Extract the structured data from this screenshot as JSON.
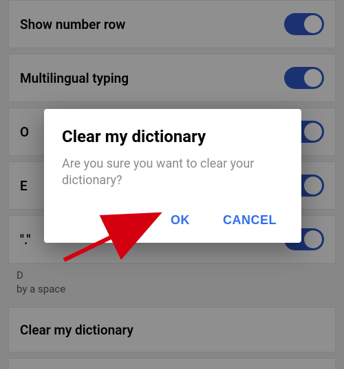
{
  "settings": {
    "rows": [
      {
        "label": "Show number row",
        "toggle": true
      },
      {
        "label": "Multilingual typing",
        "toggle": true
      },
      {
        "label": "O",
        "toggle": true
      },
      {
        "label": "E",
        "toggle": true
      },
      {
        "label": "\".\"",
        "toggle": true
      }
    ],
    "hint_partial_prefix": "D",
    "hint_partial_suffix": "by a space",
    "clear_row_label": "Clear my dictionary"
  },
  "dialog": {
    "title": "Clear my dictionary",
    "message": "Are you sure you want to clear your dictionary?",
    "ok": "OK",
    "cancel": "CANCEL"
  }
}
